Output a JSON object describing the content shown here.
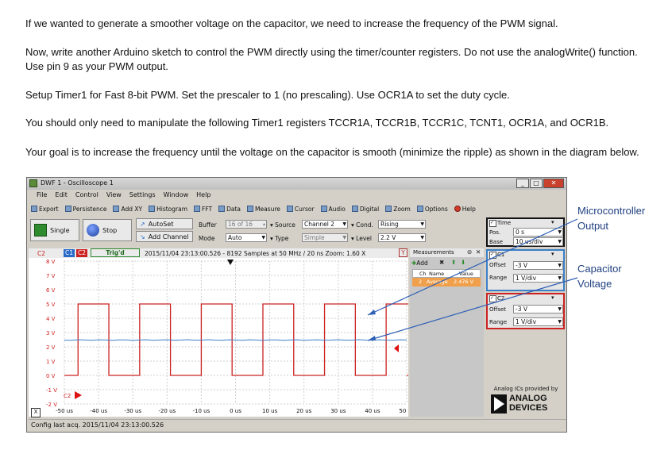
{
  "document": {
    "paragraphs": [
      "If we wanted to generate a smoother voltage on the capacitor, we need to increase the frequency of the PWM signal.",
      "Now, write another Arduino sketch to control the PWM directly using the timer/counter registers.  Do not use the analogWrite() function.  Use pin 9 as your PWM output.",
      "Setup Timer1 for Fast 8-bit PWM.  Set the prescaler to 1 (no prescaling).  Use OCR1A to set the duty cycle.",
      "You should only need to manipulate the following Timer1 registers TCCR1A, TCCR1B, TCCR1C, TCNT1, OCR1A, and OCR1B.",
      "Your goal is to increase the frequency until the voltage on the capacitor is smooth (minimize the ripple) as shown in the diagram below."
    ],
    "annotations": {
      "micro_line1": "Microcontroller",
      "micro_line2": "Output",
      "cap_line1": "Capacitor",
      "cap_line2": "Voltage"
    }
  },
  "window": {
    "title": "DWF 1 - Oscilloscope 1",
    "menu": [
      "File",
      "Edit",
      "Control",
      "View",
      "Settings",
      "Window",
      "Help"
    ],
    "toolbar": [
      "Export",
      "Persistence",
      "Add XY",
      "Histogram",
      "FFT",
      "Data",
      "Measure",
      "Cursor",
      "Audio",
      "Digital",
      "Zoom",
      "Options",
      "Help"
    ],
    "controls": {
      "single": "Single",
      "stop": "Stop",
      "autoset": "AutoSet",
      "add_channel": "Add Channel",
      "buffer_label": "Buffer",
      "buffer_value": "16 of 16",
      "mode_label": "Mode",
      "mode_value": "Auto",
      "source_label": "Source",
      "source_value": "Channel 2",
      "type_label": "Type",
      "type_value": "Simple",
      "cond_label": "Cond.",
      "cond_value": "Rising",
      "level_label": "Level",
      "level_value": "2.2 V"
    },
    "plot": {
      "active_channel": "C2",
      "ch1_tag": "C1",
      "ch2_tag": "C2",
      "trig_status": "Trig'd",
      "info": "2015/11/04 23:13:00.526 - 8192 Samples at 50 MHz / 20 ns Zoom: 1.60 X",
      "y_ticks": [
        "8 V",
        "7 V",
        "6 V",
        "5 V",
        "4 V",
        "3 V",
        "2 V",
        "1 V",
        "0 V",
        "-1 V",
        "-2 V"
      ],
      "x_ticks": [
        "-50 us",
        "-40 us",
        "-30 us",
        "-20 us",
        "-10 us",
        "0 us",
        "10 us",
        "20 us",
        "30 us",
        "40 us",
        "50 us"
      ],
      "x_button": "X",
      "y_button": "Y",
      "trace_tag": "C2",
      "colors": {
        "ch1": "#cc2222",
        "ch2": "#3a7fc8"
      }
    },
    "measurements": {
      "title": "Measurements",
      "add": "Add",
      "col_ch": "Ch",
      "col_name": "Name",
      "col_value": "Value",
      "row_ch": "2",
      "row_name": "Average",
      "row_value": "2.476 V"
    },
    "time": {
      "title": "Time",
      "pos_label": "Pos.",
      "pos_value": "0 s",
      "base_label": "Base",
      "base_value": "10 us/div"
    },
    "c1": {
      "title": "C1",
      "offset_label": "Offset",
      "offset_value": "-3 V",
      "range_label": "Range",
      "range_value": "1 V/div"
    },
    "c2": {
      "title": "C2",
      "offset_label": "Offset",
      "offset_value": "-3 V",
      "range_label": "Range",
      "range_value": "1 V/div"
    },
    "branding": {
      "caption": "Analog ICs provided by",
      "line1": "ANALOG",
      "line2": "DEVICES"
    },
    "status": "Config last acq. 2015/11/04 23:13:00.526"
  }
}
